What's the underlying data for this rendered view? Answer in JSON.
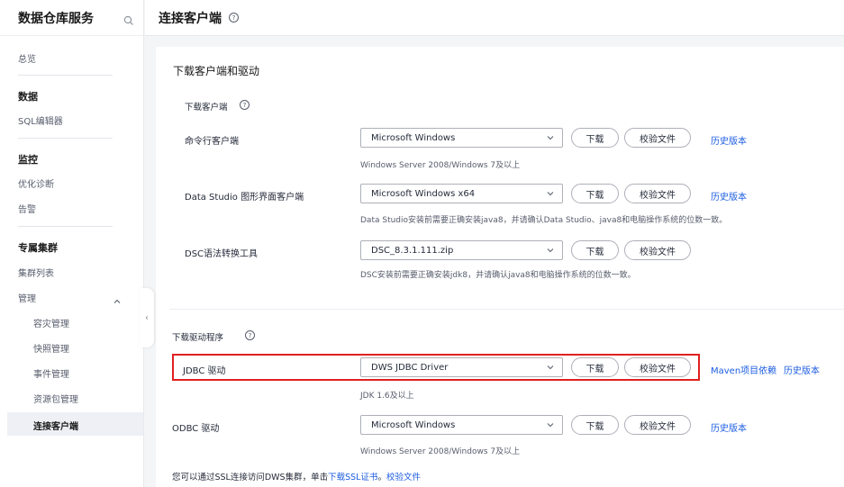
{
  "sidebar": {
    "title": "数据仓库服务",
    "overview": "总览",
    "data_group": "数据",
    "sql_editor": "SQL编辑器",
    "monitor_group": "监控",
    "diagnosis": "优化诊断",
    "alarm": "告警",
    "cluster_group": "专属集群",
    "cluster_list": "集群列表",
    "management": "管理",
    "sub_items": [
      "容灾管理",
      "快照管理",
      "事件管理",
      "资源包管理"
    ],
    "active_item": "连接客户端"
  },
  "header": {
    "title": "连接客户端",
    "help": "?"
  },
  "main": {
    "card_title": "下载客户端和驱动",
    "clients_section": "下载客户端",
    "drivers_section": "下载驱动程序",
    "help": "?",
    "download_label": "下载",
    "verify_label": "校验文件",
    "rows": [
      {
        "label": "命令行客户端",
        "select": "Microsoft Windows",
        "hint": "Windows Server 2008/Windows 7及以上",
        "link": "历史版本"
      },
      {
        "label": "Data Studio 图形界面客户端",
        "select": "Microsoft Windows x64",
        "hint": "Data Studio安装前需要正确安装java8，并请确认Data Studio、java8和电脑操作系统的位数一致。",
        "link": "历史版本"
      },
      {
        "label": "DSC语法转换工具",
        "select": "DSC_8.3.1.111.zip",
        "hint": "DSC安装前需要正确安装jdk8，并请确认java8和电脑操作系统的位数一致。"
      },
      {
        "label": "JDBC 驱动",
        "select": "DWS JDBC Driver",
        "hint": "JDK 1.6及以上",
        "link_maven": "Maven项目依赖",
        "link": "历史版本"
      },
      {
        "label": "ODBC 驱动",
        "select": "Microsoft Windows",
        "hint": "Windows Server 2008/Windows 7及以上",
        "link": "历史版本"
      }
    ],
    "ssl_text": "您可以通过SSL连接访问DWS集群，单击",
    "ssl_link": "下载SSL证书",
    "ssl_sep": "。",
    "ssl_verify_link": "校验文件"
  },
  "colors": {
    "link": "#1d5de0",
    "highlight": "#e02020",
    "active_bg": "#eef0f5"
  }
}
